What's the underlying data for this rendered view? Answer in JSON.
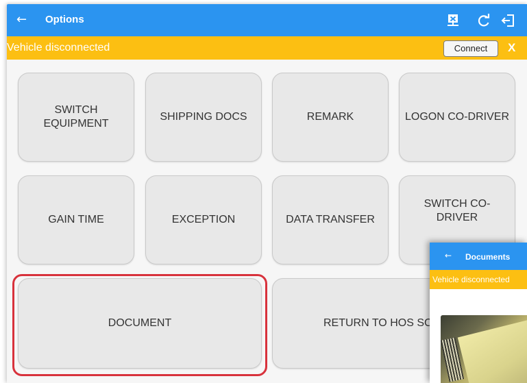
{
  "appbar": {
    "back_glyph": "←",
    "title": "Options",
    "icons": [
      "disconnect-icon",
      "refresh-icon",
      "logout-icon"
    ]
  },
  "banner": {
    "message": "Vehicle disconnected",
    "connect_label": "Connect",
    "close_label": "X"
  },
  "options": {
    "switch_equipment": [
      "SWITCH",
      "EQUIPMENT"
    ],
    "shipping_docs": "SHIPPING DOCS",
    "remark": "REMARK",
    "logon_co_driver": "LOGON CO-DRIVER",
    "gain_time": "GAIN TIME",
    "exception": "EXCEPTION",
    "data_transfer": "DATA TRANSFER",
    "switch_co_driver": [
      "SWITCH CO-",
      "DRIVER"
    ],
    "document": "DOCUMENT",
    "return_to_hos": "RETURN TO HOS SC"
  },
  "overlay": {
    "back_glyph": "←",
    "title": "Documents",
    "banner_message": "Vehicle disconnected"
  },
  "colors": {
    "primary": "#2b94f0",
    "warning": "#fcbf12",
    "highlight": "#d8323c"
  }
}
